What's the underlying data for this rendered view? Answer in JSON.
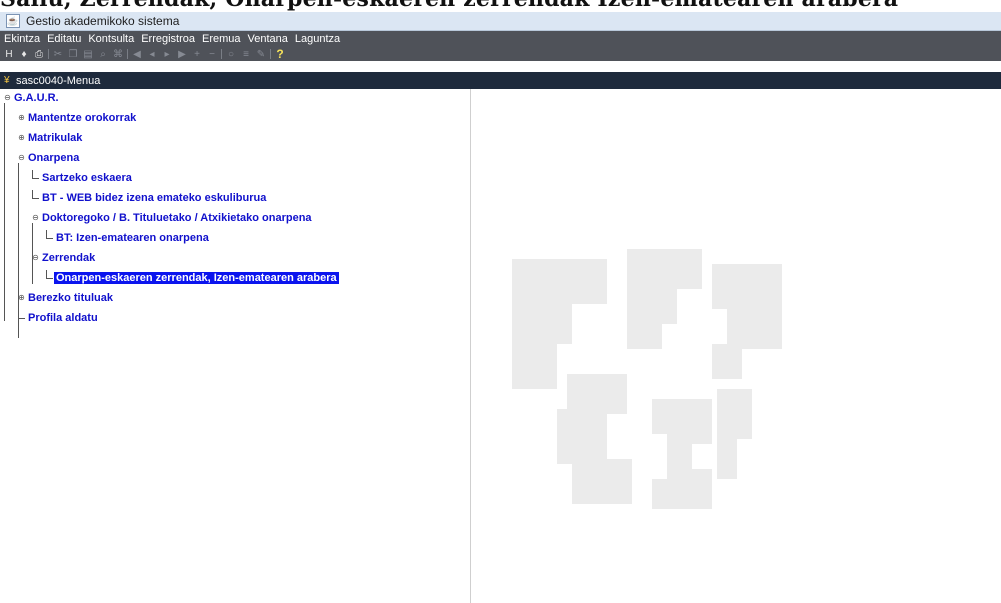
{
  "doc_heading": "Sailu, Zerrendak, Onarpen-eskaeren zerrendak Izen-ematearen arabera",
  "window": {
    "title": "Gestio akademikoko sistema",
    "app_icon": "java-app-icon"
  },
  "menubar": {
    "items": [
      "Ekintza",
      "Editatu",
      "Kontsulta",
      "Erregistroa",
      "Eremua",
      "Ventana",
      "Laguntza"
    ]
  },
  "toolbar": {
    "buttons": [
      {
        "icon": "save-icon",
        "glyph": "H"
      },
      {
        "icon": "bookmark-icon",
        "glyph": "♦"
      },
      {
        "icon": "print-icon",
        "glyph": "⎙"
      },
      {
        "icon": "cut-icon",
        "glyph": "✂",
        "dim": true
      },
      {
        "icon": "copy-icon",
        "glyph": "❐",
        "dim": true
      },
      {
        "icon": "paste-icon",
        "glyph": "▤",
        "dim": true
      },
      {
        "icon": "query-icon",
        "glyph": "⌕",
        "dim": true
      },
      {
        "icon": "execute-icon",
        "glyph": "⌘",
        "dim": true
      },
      {
        "icon": "first-record-icon",
        "glyph": "◀",
        "dim": true
      },
      {
        "icon": "previous-record-icon",
        "glyph": "◂",
        "dim": true
      },
      {
        "icon": "next-record-icon",
        "glyph": "▸",
        "dim": true
      },
      {
        "icon": "last-record-icon",
        "glyph": "▶",
        "dim": true
      },
      {
        "icon": "insert-record-icon",
        "glyph": "+",
        "dim": true
      },
      {
        "icon": "delete-record-icon",
        "glyph": "−",
        "dim": true
      },
      {
        "icon": "clear-icon",
        "glyph": "○",
        "dim": true
      },
      {
        "icon": "list-icon",
        "glyph": "≡",
        "dim": true
      },
      {
        "icon": "edit-icon",
        "glyph": "✎",
        "dim": true
      },
      {
        "icon": "help-icon",
        "glyph": "?"
      }
    ]
  },
  "subwindow": {
    "title": "sasc0040-Menua"
  },
  "tree": {
    "items": [
      {
        "label": "G.A.U.R.",
        "level": 0,
        "toggle": "minus"
      },
      {
        "label": "Mantentze orokorrak",
        "level": 1,
        "toggle": "plus"
      },
      {
        "label": "Matrikulak",
        "level": 1,
        "toggle": "plus"
      },
      {
        "label": "Onarpena",
        "level": 1,
        "toggle": "minus"
      },
      {
        "label": "Sartzeko eskaera",
        "level": 2,
        "toggle": "leaf"
      },
      {
        "label": "BT - WEB bidez izena emateko eskuliburua",
        "level": 2,
        "toggle": "leaf"
      },
      {
        "label": "Doktoregoko / B. Tituluetako / Atxikietako onarpena",
        "level": 2,
        "toggle": "minus"
      },
      {
        "label": "BT: Izen-ematearen onarpena",
        "level": 3,
        "toggle": "leaf"
      },
      {
        "label": "Zerrendak",
        "level": 2,
        "toggle": "minus"
      },
      {
        "label": "Onarpen-eskaeren zerrendak, Izen-ematearen arabera",
        "level": 3,
        "toggle": "leaf",
        "selected": true
      },
      {
        "label": "Berezko tituluak",
        "level": 1,
        "toggle": "plus"
      },
      {
        "label": "Profila aldatu",
        "level": 1,
        "toggle": "leaf"
      }
    ]
  },
  "colors": {
    "menubar_bg": "#4f5259",
    "subwindow_bg": "#1e2a3c",
    "tree_text": "#1010cc",
    "selection_bg": "#0b14ee",
    "logo_fill": "#ebebeb"
  },
  "watermark": {
    "icon": "university-logo-watermark"
  }
}
